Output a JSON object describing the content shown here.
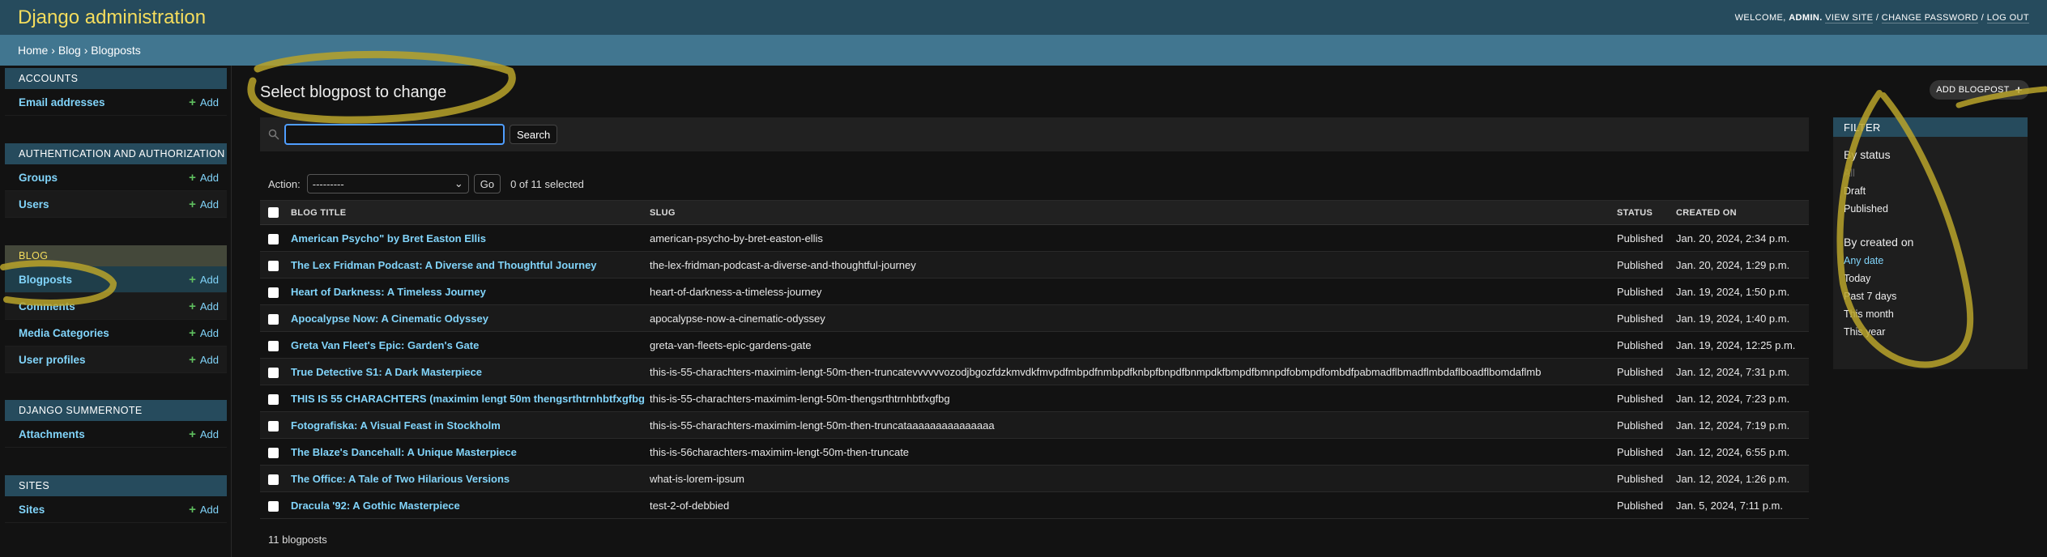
{
  "header": {
    "branding": "Django administration",
    "welcome": "WELCOME,",
    "username": "ADMIN.",
    "view_site": "VIEW SITE",
    "change_password": "CHANGE PASSWORD",
    "log_out": "LOG OUT",
    "sep": "/"
  },
  "breadcrumbs": {
    "home": "Home",
    "app": "Blog",
    "model": "Blogposts",
    "sep": "›"
  },
  "sidebar": {
    "add_label": "Add",
    "modules": [
      {
        "caption": "Accounts",
        "items": [
          {
            "label": "Email addresses"
          }
        ]
      },
      {
        "caption": "Authentication and Authorization",
        "items": [
          {
            "label": "Groups"
          },
          {
            "label": "Users"
          }
        ]
      },
      {
        "caption": "Blog",
        "items": [
          {
            "label": "Blogposts"
          },
          {
            "label": "Comments"
          },
          {
            "label": "Media Categories"
          },
          {
            "label": "User profiles"
          }
        ]
      },
      {
        "caption": "Django Summernote",
        "items": [
          {
            "label": "Attachments"
          }
        ]
      },
      {
        "caption": "Sites",
        "items": [
          {
            "label": "Sites"
          }
        ]
      }
    ]
  },
  "content": {
    "title": "Select blogpost to change",
    "search": {
      "value": "",
      "button": "Search"
    },
    "actions": {
      "label": "Action:",
      "selected": "---------",
      "go": "Go",
      "count": "0 of 11 selected"
    },
    "add_button": "ADD BLOGPOST",
    "columns": [
      "Blog title",
      "Slug",
      "Status",
      "Created on"
    ],
    "rows": [
      {
        "title": "American Psycho\" by Bret Easton Ellis",
        "slug": "american-psycho-by-bret-easton-ellis",
        "status": "Published",
        "created": "Jan. 20, 2024, 2:34 p.m."
      },
      {
        "title": "The Lex Fridman Podcast: A Diverse and Thoughtful Journey",
        "slug": "the-lex-fridman-podcast-a-diverse-and-thoughtful-journey",
        "status": "Published",
        "created": "Jan. 20, 2024, 1:29 p.m."
      },
      {
        "title": "Heart of Darkness: A Timeless Journey",
        "slug": "heart-of-darkness-a-timeless-journey",
        "status": "Published",
        "created": "Jan. 19, 2024, 1:50 p.m."
      },
      {
        "title": "Apocalypse Now: A Cinematic Odyssey",
        "slug": "apocalypse-now-a-cinematic-odyssey",
        "status": "Published",
        "created": "Jan. 19, 2024, 1:40 p.m."
      },
      {
        "title": "Greta Van Fleet's Epic: Garden's Gate",
        "slug": "greta-van-fleets-epic-gardens-gate",
        "status": "Published",
        "created": "Jan. 19, 2024, 12:25 p.m."
      },
      {
        "title": "True Detective S1: A Dark Masterpiece",
        "slug": "this-is-55-charachters-maximim-lengt-50m-then-truncatevvvvvvozodjbgozfdzkmvdkfmvpdfmbpdfnmbpdfknbpfbnpdfbnmpdkfbmpdfbmnpdfobmpdfombdfpabmadflbmadflmbdaflboadflbomdaflmb",
        "status": "Published",
        "created": "Jan. 12, 2024, 7:31 p.m."
      },
      {
        "title": "THIS IS 55 CHARACHTERS (maximim lengt 50m thengsrthtrnhbtfxgfbg",
        "slug": "this-is-55-charachters-maximim-lengt-50m-thengsrthtrnhbtfxgfbg",
        "status": "Published",
        "created": "Jan. 12, 2024, 7:23 p.m."
      },
      {
        "title": "Fotografiska: A Visual Feast in Stockholm",
        "slug": "this-is-55-charachters-maximim-lengt-50m-then-truncataaaaaaaaaaaaaaa",
        "status": "Published",
        "created": "Jan. 12, 2024, 7:19 p.m."
      },
      {
        "title": "The Blaze's Dancehall: A Unique Masterpiece",
        "slug": "this-is-56charachters-maximim-lengt-50m-then-truncate",
        "status": "Published",
        "created": "Jan. 12, 2024, 6:55 p.m."
      },
      {
        "title": "The Office: A Tale of Two Hilarious Versions",
        "slug": "what-is-lorem-ipsum",
        "status": "Published",
        "created": "Jan. 12, 2024, 1:26 p.m."
      },
      {
        "title": "Dracula '92: A Gothic Masterpiece",
        "slug": "test-2-of-debbied",
        "status": "Published",
        "created": "Jan. 5, 2024, 7:11 p.m."
      }
    ],
    "paginator": "11 blogposts"
  },
  "filter": {
    "title": "FILTER",
    "groups": [
      {
        "heading": "By status",
        "options": [
          "All",
          "Draft",
          "Published"
        ],
        "selected": 0
      },
      {
        "heading": "By created on",
        "options": [
          "Any date",
          "Today",
          "Past 7 days",
          "This month",
          "This year"
        ],
        "selected": 0
      }
    ]
  },
  "colors": {
    "header": "#264b5d",
    "breadcrumbs": "#417690",
    "branding": "#f5dd5d",
    "link": "#81d4fa",
    "annotation": "#b9a32a"
  }
}
